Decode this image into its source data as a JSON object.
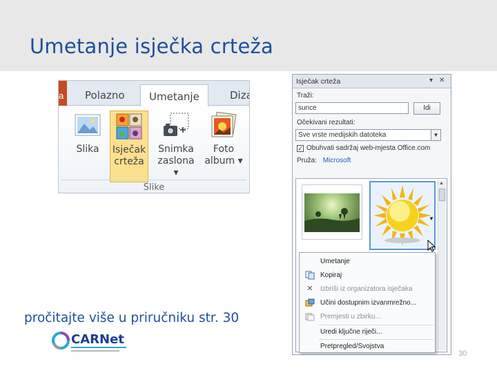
{
  "slide": {
    "title": "Umetanje isječka crteža",
    "footer_text": "pročitajte više u priručniku str. 30",
    "slide_number": "30",
    "logo_text": "CARNet"
  },
  "ribbon": {
    "file_tab_label": "a",
    "tabs": [
      {
        "label": "Polazno",
        "active": false
      },
      {
        "label": "Umetanje",
        "active": true
      },
      {
        "label": "Dizajn",
        "active": false
      }
    ],
    "buttons": [
      {
        "label": [
          "Slika"
        ],
        "icon": "picture-icon",
        "selected": false
      },
      {
        "label": [
          "Isječak",
          "crteža"
        ],
        "icon": "clip-art-icon",
        "selected": true
      },
      {
        "label": [
          "Snimka",
          "zaslona ▾"
        ],
        "icon": "screenshot-icon",
        "selected": false
      },
      {
        "label": [
          "Foto",
          "album ▾"
        ],
        "icon": "photo-album-icon",
        "selected": false
      }
    ],
    "group_label": "Slike"
  },
  "pane": {
    "title": "Isječak crteža",
    "search_label": "Traži:",
    "search_value": "sunce",
    "go_button": "Idi",
    "results_label": "Očekivani rezultati:",
    "results_value": "Sve vrste medijskih datoteka",
    "include_checkbox_label": "Obuhvati sadržaj web-mjesta Office.com",
    "include_checked": true,
    "search_by_label": "Pruža:",
    "search_by_value": "Microsoft",
    "menu": [
      {
        "label": "Umetanje",
        "icon": "",
        "disabled": false
      },
      {
        "label": "Kopiraj",
        "icon": "copy-icon",
        "disabled": false
      },
      {
        "label": "Izbriši iz organizatora isječaka",
        "icon": "delete-icon",
        "disabled": true
      },
      {
        "label": "Učini dostupnim izvanmrežno...",
        "icon": "offline-icon",
        "disabled": false
      },
      {
        "label": "Premjesti u zbirku...",
        "icon": "move-icon",
        "disabled": true
      },
      {
        "label": "Uredi ključne riječi...",
        "icon": "",
        "disabled": false
      },
      {
        "label": "Pretpregled/Svojstva",
        "icon": "",
        "disabled": false
      }
    ]
  }
}
